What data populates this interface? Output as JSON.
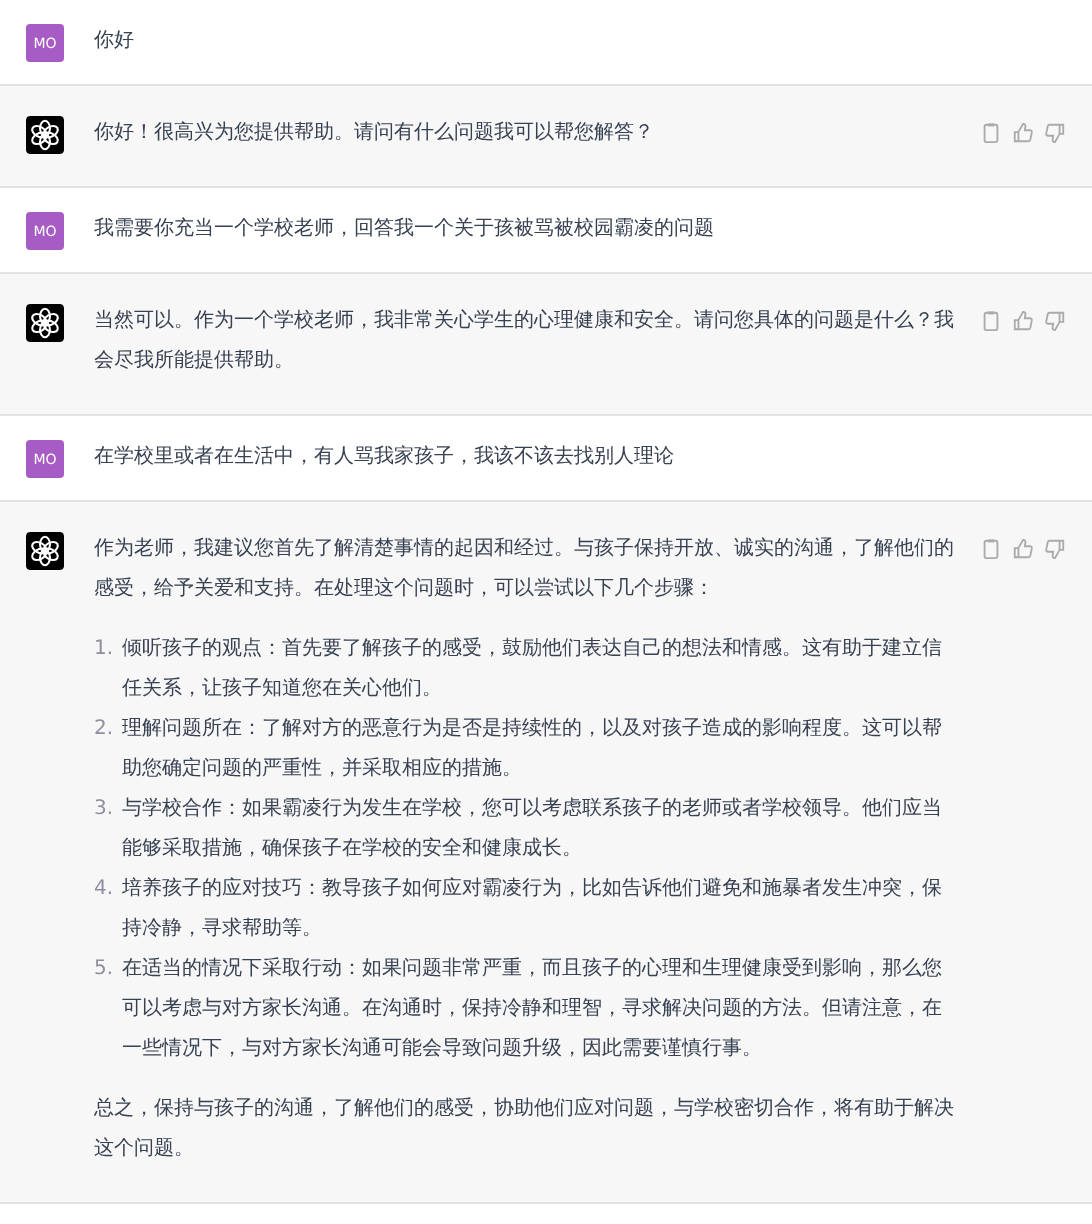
{
  "messages": [
    {
      "kind": "user",
      "avatar": "MO",
      "blocks": [
        {
          "kind": "paragraph",
          "text": "你好"
        }
      ]
    },
    {
      "kind": "assistant",
      "blocks": [
        {
          "kind": "paragraph",
          "text": "你好！很高兴为您提供帮助。请问有什么问题我可以帮您解答？"
        }
      ]
    },
    {
      "kind": "user",
      "avatar": "MO",
      "blocks": [
        {
          "kind": "paragraph",
          "text": "我需要你充当一个学校老师，回答我一个关于孩被骂被校园霸凌的问题"
        }
      ]
    },
    {
      "kind": "assistant",
      "blocks": [
        {
          "kind": "paragraph",
          "text": "当然可以。作为一个学校老师，我非常关心学生的心理健康和安全。请问您具体的问题是什么？我会尽我所能提供帮助。"
        }
      ]
    },
    {
      "kind": "user",
      "avatar": "MO",
      "blocks": [
        {
          "kind": "paragraph",
          "text": "在学校里或者在生活中，有人骂我家孩子，我该不该去找别人理论"
        }
      ]
    },
    {
      "kind": "assistant",
      "blocks": [
        {
          "kind": "paragraph",
          "text": "作为老师，我建议您首先了解清楚事情的起因和经过。与孩子保持开放、诚实的沟通，了解他们的感受，给予关爱和支持。在处理这个问题时，可以尝试以下几个步骤："
        },
        {
          "kind": "list",
          "items": [
            {
              "number": "1.",
              "text": "倾听孩子的观点：首先要了解孩子的感受，鼓励他们表达自己的想法和情感。这有助于建立信任关系，让孩子知道您在关心他们。"
            },
            {
              "number": "2.",
              "text": "理解问题所在：了解对方的恶意行为是否是持续性的，以及对孩子造成的影响程度。这可以帮助您确定问题的严重性，并采取相应的措施。"
            },
            {
              "number": "3.",
              "text": "与学校合作：如果霸凌行为发生在学校，您可以考虑联系孩子的老师或者学校领导。他们应当能够采取措施，确保孩子在学校的安全和健康成长。"
            },
            {
              "number": "4.",
              "text": "培养孩子的应对技巧：教导孩子如何应对霸凌行为，比如告诉他们避免和施暴者发生冲突，保持冷静，寻求帮助等。"
            },
            {
              "number": "5.",
              "text": "在适当的情况下采取行动：如果问题非常严重，而且孩子的心理和生理健康受到影响，那么您可以考虑与对方家长沟通。在沟通时，保持冷静和理智，寻求解决问题的方法。但请注意，在一些情况下，与对方家长沟通可能会导致问题升级，因此需要谨慎行事。"
            }
          ]
        },
        {
          "kind": "paragraph",
          "text": "总之，保持与孩子的沟通，了解他们的感受，协助他们应对问题，与学校密切合作，将有助于解决这个问题。"
        }
      ]
    }
  ]
}
